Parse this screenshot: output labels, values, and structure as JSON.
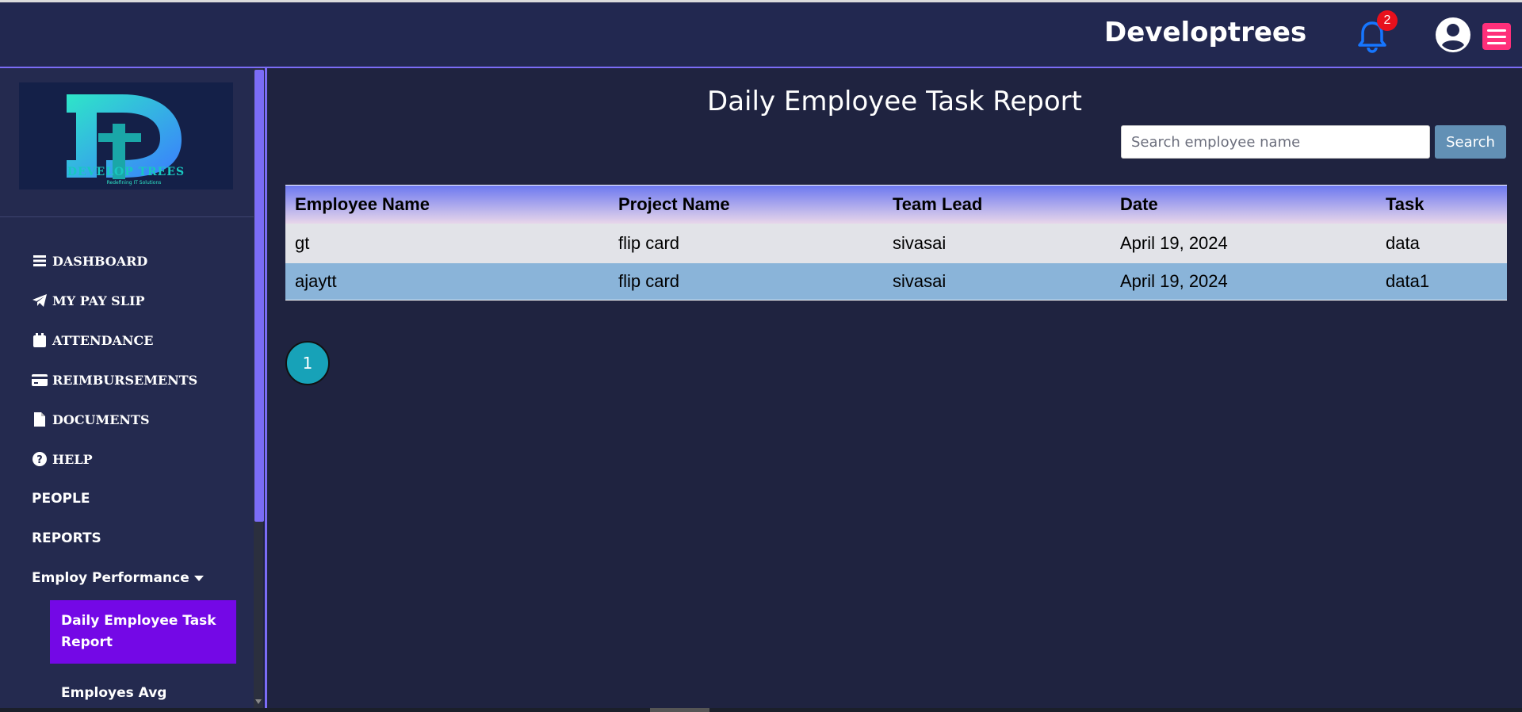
{
  "header": {
    "brand": "Developtrees",
    "notification_count": "2",
    "icons": [
      "bell-icon",
      "user-avatar-icon",
      "hamburger-menu-icon"
    ],
    "colors": {
      "bar": "#222850",
      "bell": "#1676ff",
      "badge": "#e8101c",
      "menu": "#ff2f7a"
    }
  },
  "sidebar": {
    "logo_alt": "DEVELOPTREES",
    "logo_tagline": "Redefining IT Solutions",
    "items": [
      {
        "label": "DASHBOARD",
        "icon": "bars-icon"
      },
      {
        "label": "MY PAY SLIP",
        "icon": "paper-plane-icon"
      },
      {
        "label": "ATTENDANCE",
        "icon": "calendar-icon"
      },
      {
        "label": "REIMBURSEMENTS",
        "icon": "credit-card-icon"
      },
      {
        "label": "DOCUMENTS",
        "icon": "file-icon"
      },
      {
        "label": "HELP",
        "icon": "question-circle-icon"
      },
      {
        "label": "PEOPLE"
      },
      {
        "label": "REPORTS"
      },
      {
        "label": "Employ Performance",
        "icon": "caret-down-icon"
      }
    ],
    "submenu": {
      "active_label": "Daily Employee Task Report",
      "next_label": "Employes Avg"
    },
    "colors": {
      "active": "#7408e6",
      "accent": "#7b6cf6"
    }
  },
  "main": {
    "title": "Daily Employee Task Report",
    "search": {
      "placeholder": "Search employee name",
      "button_label": "Search"
    },
    "table": {
      "headers": [
        "Employee Name",
        "Project Name",
        "Team Lead",
        "Date",
        "Task"
      ],
      "rows": [
        [
          "gt",
          "flip card",
          "sivasai",
          "April 19, 2024",
          "data"
        ],
        [
          "ajaytt",
          "flip card",
          "sivasai",
          "April 19, 2024",
          "data1"
        ]
      ]
    },
    "pagination": {
      "current_page": "1"
    }
  }
}
